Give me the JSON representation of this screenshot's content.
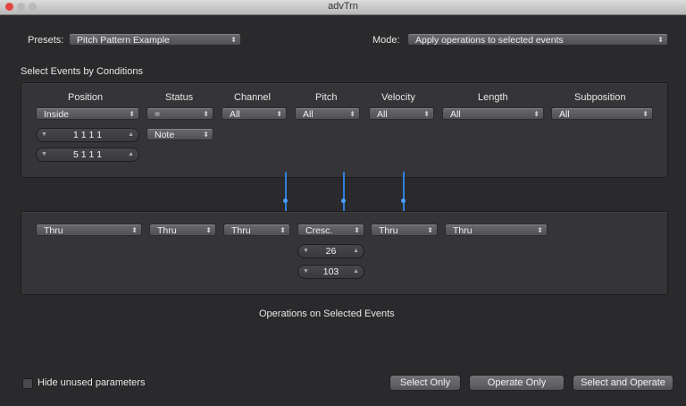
{
  "window": {
    "title": "advTrn"
  },
  "presets": {
    "label": "Presets:",
    "value": "Pitch Pattern Example"
  },
  "mode": {
    "label": "Mode:",
    "value": "Apply operations to selected events"
  },
  "conditions": {
    "heading": "Select Events by Conditions",
    "columns": [
      "Position",
      "Status",
      "Channel",
      "Pitch",
      "Velocity",
      "Length",
      "Subposition"
    ],
    "row1": [
      "Inside",
      "=",
      "All",
      "All",
      "All",
      "All",
      "All"
    ],
    "status_value": "Note",
    "position_start": "1 1 1     1",
    "position_end": "5 1 1     1"
  },
  "operations": {
    "row": [
      "Thru",
      "Thru",
      "Thru",
      "Cresc.",
      "Thru",
      "Thru"
    ],
    "pitch_value1": "26",
    "pitch_value2": "103",
    "caption": "Operations on Selected Events"
  },
  "footer": {
    "hide_unused": "Hide unused parameters",
    "select_only": "Select Only",
    "operate_only": "Operate Only",
    "select_and_operate": "Select and Operate"
  },
  "colors": {
    "accent": "#2f7fd9",
    "close": "#e2463f"
  }
}
